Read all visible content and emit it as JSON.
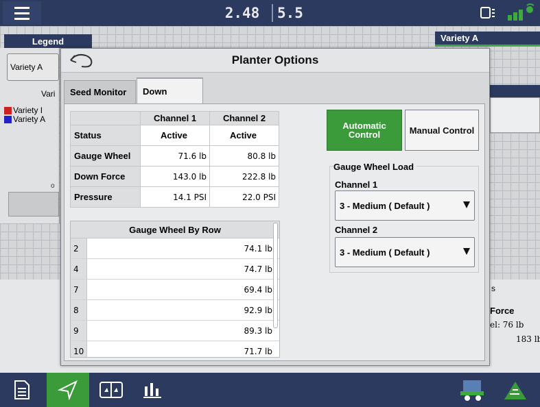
{
  "topbar": {
    "speed": "2.48",
    "rate": "5.5",
    "icons": [
      "menu-icon",
      "display-icon",
      "gps-signal-icon"
    ]
  },
  "background": {
    "legend_label": "Legend",
    "variety_button": "Variety A",
    "vari_label": "Vari",
    "legend_rows": [
      {
        "label": "Variety I",
        "color": "#cc2222"
      },
      {
        "label": "Variety A",
        "color": "#2222cc"
      }
    ],
    "small_o": "o",
    "variety_tab": "Variety A",
    "right_s": "s",
    "right_force": "Force",
    "right_line1": "el:    76 lb",
    "right_line2": "183 lb"
  },
  "dialog": {
    "title": "Planter Options",
    "tabs": [
      {
        "label": "Seed Monitor",
        "active": false
      },
      {
        "label": "Down",
        "active": true
      }
    ],
    "status_table": {
      "headers": [
        "",
        "Channel 1",
        "Channel 2"
      ],
      "rows": [
        {
          "label": "Status",
          "ch1": "Active",
          "ch2": "Active"
        },
        {
          "label": "Gauge Wheel",
          "ch1": "71.6 lb",
          "ch2": "80.8 lb"
        },
        {
          "label": "Down Force",
          "ch1": "143.0 lb",
          "ch2": "222.8 lb"
        },
        {
          "label": "Pressure",
          "ch1": "14.1 PSI",
          "ch2": "22.0 PSI"
        }
      ]
    },
    "gauge_by_row": {
      "title": "Gauge Wheel By Row",
      "rows": [
        {
          "row": "2",
          "value": "74.1 lb"
        },
        {
          "row": "4",
          "value": "74.7 lb"
        },
        {
          "row": "7",
          "value": "69.4 lb"
        },
        {
          "row": "8",
          "value": "92.9 lb"
        },
        {
          "row": "9",
          "value": "89.3 lb"
        },
        {
          "row": "10",
          "value": "71.7 lb"
        }
      ]
    },
    "control": {
      "automatic_label": "Automatic Control",
      "manual_label": "Manual Control",
      "selected": "Automatic Control"
    },
    "gauge_wheel_load": {
      "title": "Gauge Wheel Load",
      "channel1_label": "Channel 1",
      "channel1_value": "3 - Medium ( Default )",
      "channel2_label": "Channel 2",
      "channel2_value": "3 - Medium ( Default )"
    }
  },
  "bottombar": {
    "icons": [
      "report-icon",
      "navigation-icon",
      "split-view-icon",
      "bar-chart-icon",
      "planter-icon",
      "field-icon"
    ],
    "active": "navigation-icon",
    "colors": {
      "bar": "#2c3a60",
      "active": "#3b9b3b"
    }
  }
}
